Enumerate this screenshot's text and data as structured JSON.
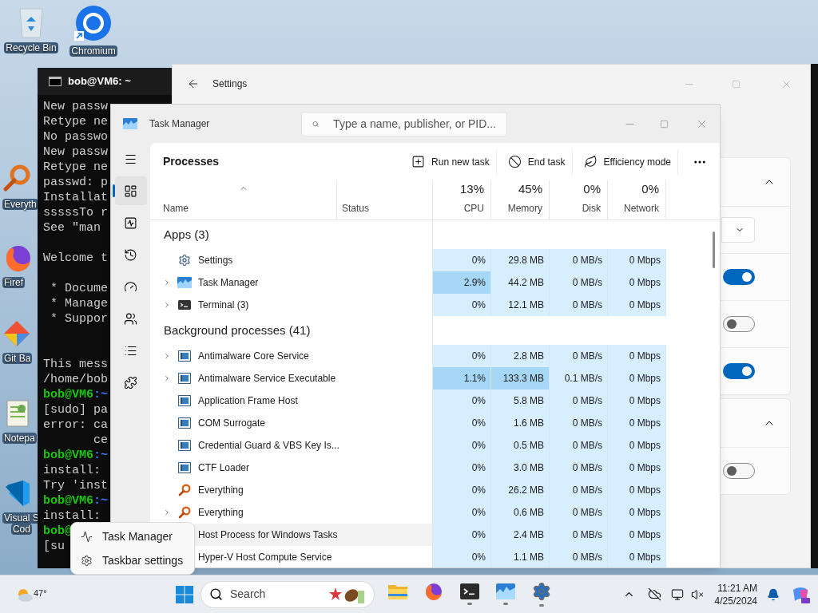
{
  "desktop_icons": [
    {
      "kind": "recycle",
      "lines": [
        "Recycle Bin"
      ]
    },
    {
      "kind": "browser",
      "lines": [
        "Chromium"
      ]
    },
    {
      "kind": "magnifier",
      "lines": [
        "Everyth"
      ]
    },
    {
      "kind": "fox",
      "lines": [
        "Firef"
      ]
    },
    {
      "kind": "diamond",
      "lines": [
        "Git Ba"
      ]
    },
    {
      "kind": "notepad",
      "lines": [
        "Notepa"
      ]
    },
    {
      "kind": "code",
      "lines": [
        "Visual S",
        "Cod"
      ]
    }
  ],
  "terminal": {
    "title": "bob@VM6: ~",
    "lines": [
      {
        "kind": "output",
        "text": "New passw"
      },
      {
        "kind": "output",
        "text": "Retype ne"
      },
      {
        "kind": "output",
        "text": "No passwo"
      },
      {
        "kind": "output",
        "text": "New passw"
      },
      {
        "kind": "output",
        "text": "Retype ne"
      },
      {
        "kind": "output",
        "text": "passwd: p"
      },
      {
        "kind": "output",
        "text": "Installat"
      },
      {
        "kind": "output",
        "text": "sssssTo r"
      },
      {
        "kind": "output",
        "text": "See \"man"
      },
      {
        "kind": "blank"
      },
      {
        "kind": "output",
        "text": "Welcome t"
      },
      {
        "kind": "blank"
      },
      {
        "kind": "output",
        "text": " * Docume"
      },
      {
        "kind": "output",
        "text": " * Manage"
      },
      {
        "kind": "output",
        "text": " * Suppor"
      },
      {
        "kind": "blank"
      },
      {
        "kind": "blank"
      },
      {
        "kind": "output",
        "text": "This mess"
      },
      {
        "kind": "output",
        "text": "/home/bob"
      },
      {
        "kind": "prompt",
        "user": "bob@VM6",
        "path": ":~"
      },
      {
        "kind": "output",
        "text": "[sudo] pa"
      },
      {
        "kind": "output",
        "text": "error: ca"
      },
      {
        "kind": "output",
        "text": "       ce"
      },
      {
        "kind": "prompt",
        "user": "bob@VM6",
        "path": ":~"
      },
      {
        "kind": "output",
        "text": "install: "
      },
      {
        "kind": "output",
        "text": "Try 'inst"
      },
      {
        "kind": "prompt",
        "user": "bob@VM6",
        "path": ":~"
      },
      {
        "kind": "output",
        "text": "install:"
      },
      {
        "kind": "prompt",
        "user": "bob@"
      },
      {
        "kind": "output",
        "text": "[su"
      }
    ]
  },
  "settings_window": {
    "title": "Settings",
    "sections": [
      {
        "expanded": true,
        "rows": [
          {
            "kind": "dropdown"
          },
          {
            "kind": "toggle",
            "on": true
          },
          {
            "kind": "toggle",
            "on": false
          },
          {
            "kind": "toggle",
            "on": true
          }
        ]
      },
      {
        "expanded": true,
        "rows": [
          {
            "kind": "toggle",
            "on": false
          }
        ]
      }
    ]
  },
  "task_manager": {
    "title": "Task Manager",
    "search": {
      "placeholder": "Type a name, publisher, or PID..."
    },
    "nav": [
      {
        "kind": "processes",
        "selected": true
      },
      {
        "kind": "performance",
        "selected": false
      },
      {
        "kind": "history",
        "selected": false
      },
      {
        "kind": "startup",
        "selected": false
      },
      {
        "kind": "users",
        "selected": false
      },
      {
        "kind": "details",
        "selected": false
      },
      {
        "kind": "services",
        "selected": false
      }
    ],
    "page_title": "Processes",
    "actions": [
      {
        "kind": "run",
        "label": "Run new task"
      },
      {
        "kind": "end",
        "label": "End task"
      },
      {
        "kind": "leaf",
        "label": "Efficiency mode"
      }
    ],
    "columns": [
      {
        "label": "Name",
        "sorted": true
      },
      {
        "label": "Status",
        "sorted": false
      },
      {
        "label": "CPU",
        "total": "13%",
        "sorted": false
      },
      {
        "label": "Memory",
        "total": "45%",
        "sorted": false
      },
      {
        "label": "Disk",
        "total": "0%",
        "sorted": false
      },
      {
        "label": "Network",
        "total": "0%",
        "sorted": false
      }
    ],
    "groups": [
      {
        "title": "Apps (3)",
        "rows": [
          {
            "name": "Settings",
            "kind": "gear",
            "expandable": false,
            "hovered": false,
            "cells": [
              {
                "text": "0%",
                "highlighted": false
              },
              {
                "text": "29.8 MB",
                "highlighted": false
              },
              {
                "text": "0 MB/s",
                "highlighted": false
              },
              {
                "text": "0 Mbps",
                "highlighted": false
              }
            ]
          },
          {
            "name": "Task Manager",
            "kind": "taskmgr",
            "expandable": true,
            "hovered": false,
            "cells": [
              {
                "text": "2.9%",
                "highlighted": true
              },
              {
                "text": "44.2 MB",
                "highlighted": false
              },
              {
                "text": "0 MB/s",
                "highlighted": false
              },
              {
                "text": "0 Mbps",
                "highlighted": false
              }
            ]
          },
          {
            "name": "Terminal (3)",
            "kind": "terminal",
            "expandable": true,
            "hovered": false,
            "cells": [
              {
                "text": "0%",
                "highlighted": false
              },
              {
                "text": "12.1 MB",
                "highlighted": false
              },
              {
                "text": "0 MB/s",
                "highlighted": false
              },
              {
                "text": "0 Mbps",
                "highlighted": false
              }
            ]
          }
        ]
      },
      {
        "title": "Background processes (41)",
        "rows": [
          {
            "name": "Antimalware Core Service",
            "kind": "service",
            "expandable": true,
            "hovered": false,
            "cells": [
              {
                "text": "0%",
                "highlighted": false
              },
              {
                "text": "2.8 MB",
                "highlighted": false
              },
              {
                "text": "0 MB/s",
                "highlighted": false
              },
              {
                "text": "0 Mbps",
                "highlighted": false
              }
            ]
          },
          {
            "name": "Antimalware Service Executable",
            "kind": "service",
            "expandable": true,
            "hovered": false,
            "cells": [
              {
                "text": "1.1%",
                "highlighted": true
              },
              {
                "text": "133.3 MB",
                "highlighted": true
              },
              {
                "text": "0.1 MB/s",
                "highlighted": false
              },
              {
                "text": "0 Mbps",
                "highlighted": false
              }
            ]
          },
          {
            "name": "Application Frame Host",
            "kind": "service",
            "expandable": false,
            "hovered": false,
            "cells": [
              {
                "text": "0%",
                "highlighted": false
              },
              {
                "text": "5.8 MB",
                "highlighted": false
              },
              {
                "text": "0 MB/s",
                "highlighted": false
              },
              {
                "text": "0 Mbps",
                "highlighted": false
              }
            ]
          },
          {
            "name": "COM Surrogate",
            "kind": "service",
            "expandable": false,
            "hovered": false,
            "cells": [
              {
                "text": "0%",
                "highlighted": false
              },
              {
                "text": "1.6 MB",
                "highlighted": false
              },
              {
                "text": "0 MB/s",
                "highlighted": false
              },
              {
                "text": "0 Mbps",
                "highlighted": false
              }
            ]
          },
          {
            "name": "Credential Guard & VBS Key Is...",
            "kind": "service",
            "expandable": false,
            "hovered": false,
            "cells": [
              {
                "text": "0%",
                "highlighted": false
              },
              {
                "text": "0.5 MB",
                "highlighted": false
              },
              {
                "text": "0 MB/s",
                "highlighted": false
              },
              {
                "text": "0 Mbps",
                "highlighted": false
              }
            ]
          },
          {
            "name": "CTF Loader",
            "kind": "service",
            "expandable": false,
            "hovered": false,
            "cells": [
              {
                "text": "0%",
                "highlighted": false
              },
              {
                "text": "3.0 MB",
                "highlighted": false
              },
              {
                "text": "0 MB/s",
                "highlighted": false
              },
              {
                "text": "0 Mbps",
                "highlighted": false
              }
            ]
          },
          {
            "name": "Everything",
            "kind": "magnifier",
            "expandable": false,
            "hovered": false,
            "cells": [
              {
                "text": "0%",
                "highlighted": false
              },
              {
                "text": "26.2 MB",
                "highlighted": false
              },
              {
                "text": "0 MB/s",
                "highlighted": false
              },
              {
                "text": "0 Mbps",
                "highlighted": false
              }
            ]
          },
          {
            "name": "Everything",
            "kind": "magnifier",
            "expandable": true,
            "hovered": false,
            "cells": [
              {
                "text": "0%",
                "highlighted": false
              },
              {
                "text": "0.6 MB",
                "highlighted": false
              },
              {
                "text": "0 MB/s",
                "highlighted": false
              },
              {
                "text": "0 Mbps",
                "highlighted": false
              }
            ]
          },
          {
            "name": "Host Process for Windows Tasks",
            "kind": "hidden",
            "hovered": true,
            "cells": [
              {
                "text": "0%",
                "highlighted": false
              },
              {
                "text": "2.4 MB",
                "highlighted": false
              },
              {
                "text": "0 MB/s",
                "highlighted": false
              },
              {
                "text": "0 Mbps",
                "highlighted": false
              }
            ]
          },
          {
            "name": "Hyper-V Host Compute Service",
            "kind": "hidden",
            "hovered": false,
            "cells": [
              {
                "text": "0%",
                "highlighted": false
              },
              {
                "text": "1.1 MB",
                "highlighted": false
              },
              {
                "text": "0 MB/s",
                "highlighted": false
              },
              {
                "text": "0 Mbps",
                "highlighted": false
              }
            ]
          }
        ]
      }
    ]
  },
  "context_menu": [
    {
      "kind": "pulse",
      "label": "Task Manager"
    },
    {
      "kind": "gear",
      "label": "Taskbar settings"
    }
  ],
  "taskbar": {
    "weather": "47°",
    "search": {
      "placeholder": "Search"
    },
    "apps": [
      {
        "kind": "explorer",
        "running": false
      },
      {
        "kind": "fox",
        "running": false
      },
      {
        "kind": "terminal",
        "running": true
      },
      {
        "kind": "taskmgr",
        "running": true
      },
      {
        "kind": "settings",
        "running": true
      }
    ],
    "time": "11:21 AM",
    "date": "4/25/2024"
  }
}
